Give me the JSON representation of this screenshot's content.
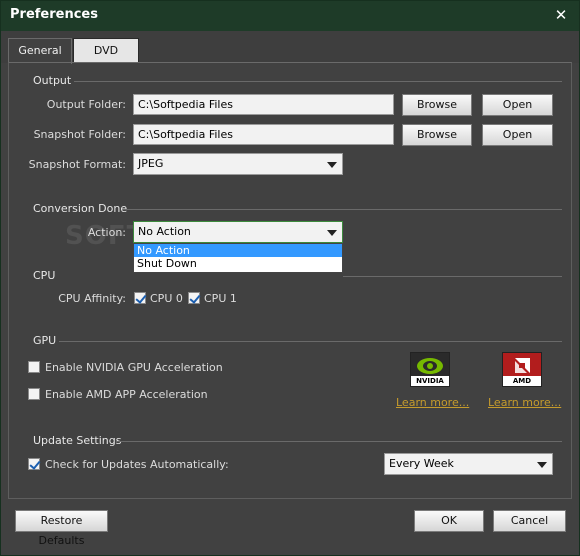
{
  "window": {
    "title": "Preferences"
  },
  "tabs": [
    {
      "label": "General"
    },
    {
      "label": "DVD"
    }
  ],
  "output": {
    "group_label": "Output",
    "output_folder_label": "Output Folder:",
    "output_folder_value": "C:\\Softpedia Files",
    "snapshot_folder_label": "Snapshot Folder:",
    "snapshot_folder_value": "C:\\Softpedia Files",
    "browse_label": "Browse",
    "open_label": "Open",
    "snapshot_format_label": "Snapshot Format:",
    "snapshot_format_value": "JPEG"
  },
  "conversion": {
    "group_label": "Conversion Done",
    "action_label": "Action:",
    "action_value": "No Action",
    "options": [
      "No Action",
      "Shut Down"
    ]
  },
  "cpu": {
    "group_label": "CPU",
    "affinity_label": "CPU Affinity:",
    "cpu0_label": "CPU 0",
    "cpu1_label": "CPU 1",
    "cpu0_checked": true,
    "cpu1_checked": true
  },
  "gpu": {
    "group_label": "GPU",
    "nvidia_label": "Enable NVIDIA GPU Acceleration",
    "amd_label": "Enable AMD APP Acceleration",
    "nvidia_checked": false,
    "amd_checked": false,
    "nvidia_logo_text": "NVIDIA",
    "amd_logo_text": "AMD",
    "learn_more_label": "Learn more..."
  },
  "update": {
    "group_label": "Update Settings",
    "check_label": "Check for Updates Automatically:",
    "check_checked": true,
    "frequency_value": "Every Week"
  },
  "footer": {
    "restore_label": "Restore Defaults",
    "ok_label": "OK",
    "cancel_label": "Cancel"
  },
  "watermark": "SOFTPEDIA",
  "colors": {
    "titlebar": "#1e3b28",
    "panel": "#414141",
    "link": "#c59b2c",
    "selection": "#3399ff"
  }
}
